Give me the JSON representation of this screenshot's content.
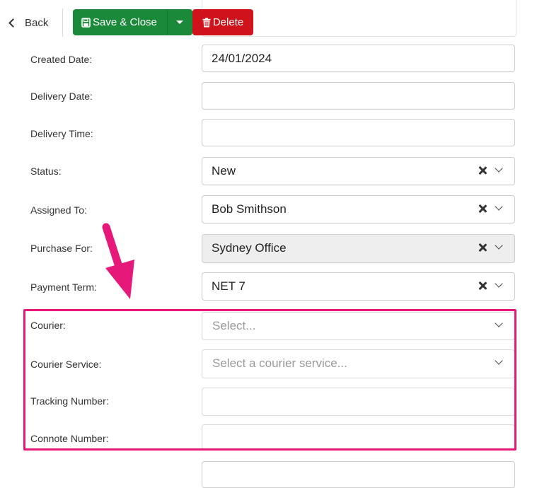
{
  "toolbar": {
    "back_label": "Back",
    "save_label": "Save & Close",
    "delete_label": "Delete"
  },
  "form": {
    "created_date": {
      "label": "Created Date:",
      "value": "24/01/2024"
    },
    "delivery_date": {
      "label": "Delivery Date:",
      "value": ""
    },
    "delivery_time": {
      "label": "Delivery Time:",
      "value": ""
    },
    "status": {
      "label": "Status:",
      "value": "New"
    },
    "assigned_to": {
      "label": "Assigned To:",
      "value": "Bob Smithson"
    },
    "purchase_for": {
      "label": "Purchase For:",
      "value": "Sydney Office"
    },
    "payment_term": {
      "label": "Payment Term:",
      "value": "NET 7"
    },
    "courier": {
      "label": "Courier:",
      "placeholder": "Select..."
    },
    "courier_service": {
      "label": "Courier Service:",
      "placeholder": "Select a courier service..."
    },
    "tracking_number": {
      "label": "Tracking Number:",
      "value": ""
    },
    "connote_number": {
      "label": "Connote Number:",
      "value": ""
    }
  },
  "colors": {
    "save_green": "#1a8a3a",
    "delete_red": "#d0121b",
    "highlight_pink": "#e6197a",
    "disabled_grey": "#eeeeee"
  },
  "icons": [
    "chevron-left-icon",
    "save-icon",
    "caret-down-icon",
    "trash-icon",
    "clear-icon",
    "chevron-down-icon",
    "annotation-arrow"
  ]
}
